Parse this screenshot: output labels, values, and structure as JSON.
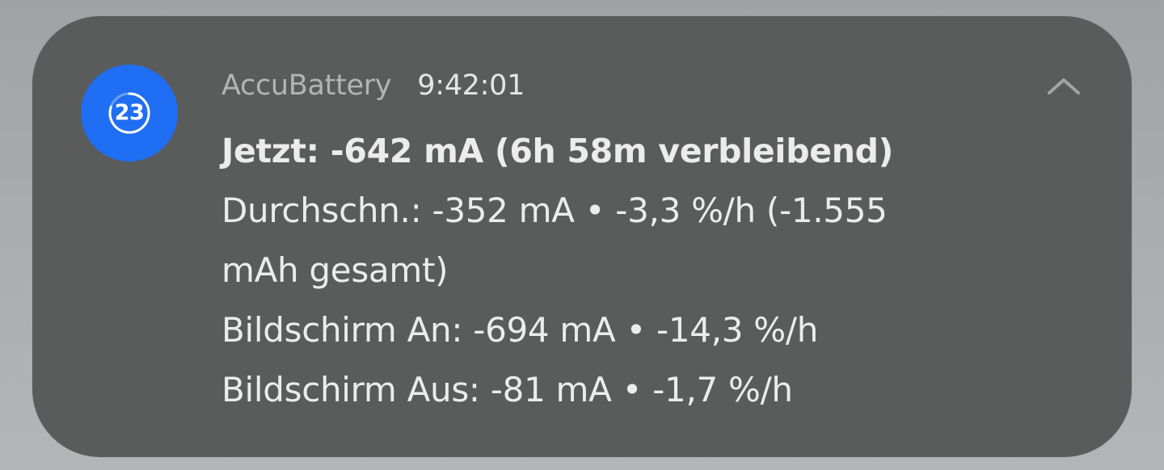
{
  "notification": {
    "app_icon_number": "23",
    "app_name": "AccuBattery",
    "time": "9:42:01",
    "collapse_icon": "chevron-up-icon",
    "lines": [
      "Jetzt: -642 mA (6h 58m verbleibend)",
      "Durchschn.: -352 mA • -3,3 %/h (-1.555",
      "mAh gesamt)",
      "Bildschirm An: -694 mA • -14,3 %/h",
      "Bildschirm Aus: -81 mA • -1,7 %/h"
    ]
  },
  "colors": {
    "card_background": "#5a5b5b",
    "app_icon_background": "#1f6ef3",
    "text_primary": "#ececec",
    "app_name": "#b3b4b4"
  }
}
